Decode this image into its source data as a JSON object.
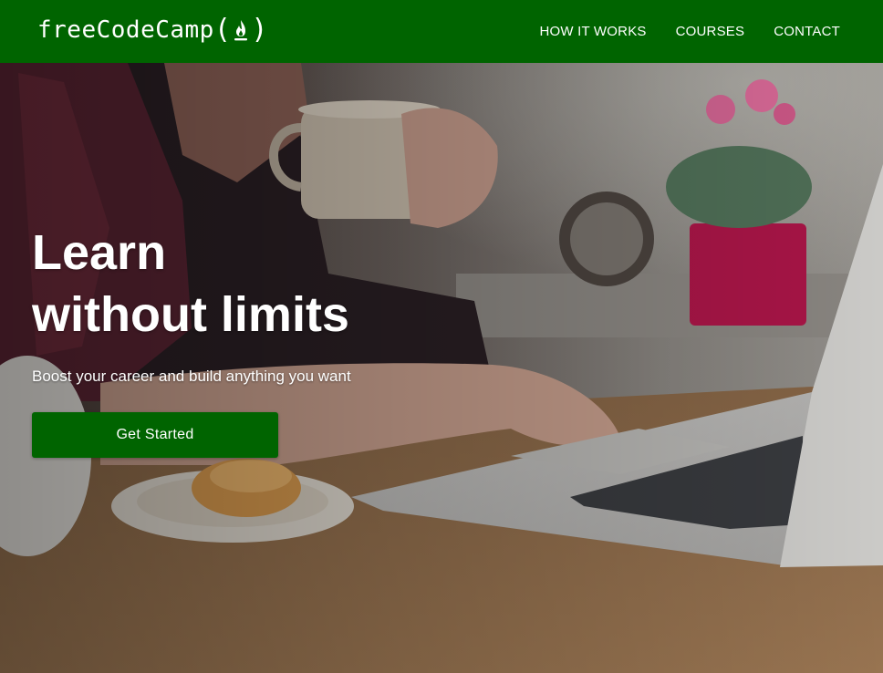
{
  "navbar": {
    "logo_text": "freeCodeCamp",
    "logo_open_paren": "(",
    "logo_close_paren": ")",
    "logo_icon": "flame-icon",
    "background_color": "#006400",
    "links": [
      {
        "label": "HOW IT WORKS"
      },
      {
        "label": "COURSES"
      },
      {
        "label": "CONTACT"
      }
    ]
  },
  "hero": {
    "title_line1": "Learn",
    "title_line2": "without limits",
    "subtitle": "Boost your career and build anything you want",
    "cta_label": "Get Started",
    "cta_color": "#006400"
  }
}
